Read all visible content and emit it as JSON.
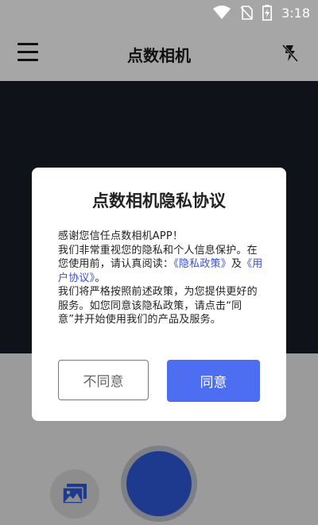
{
  "status_bar": {
    "time": "3:18",
    "icons": [
      "wifi-icon",
      "no-sim-icon",
      "battery-charging-icon"
    ]
  },
  "app_bar": {
    "title": "点数相机",
    "menu_icon": "menu-icon",
    "flash_icon": "flash-off-icon"
  },
  "dialog": {
    "title": "点数相机隐私协议",
    "body": {
      "line1": "感谢您信任点数相机APP！",
      "p2_before": "我们非常重视您的隐私和个人信息保护。在您使用前，请认真阅读：",
      "privacy_link": "《隐私政策》",
      "and": "及",
      "user_link": "《用户协议》",
      "p2_after": "。",
      "p3": "我们将严格按照前述政策，为您提供更好的服务。如您同意该隐私政策，请点击“同意”并开始使用我们的产品及服务。"
    },
    "disagree_label": "不同意",
    "agree_label": "同意"
  },
  "bottom": {
    "gallery_icon": "gallery-icon",
    "shutter": "shutter-button"
  },
  "colors": {
    "accent": "#4e6ef2",
    "link": "#3a4fd6",
    "shutter": "#1e3a8f",
    "viewfinder": "#0f1319"
  }
}
